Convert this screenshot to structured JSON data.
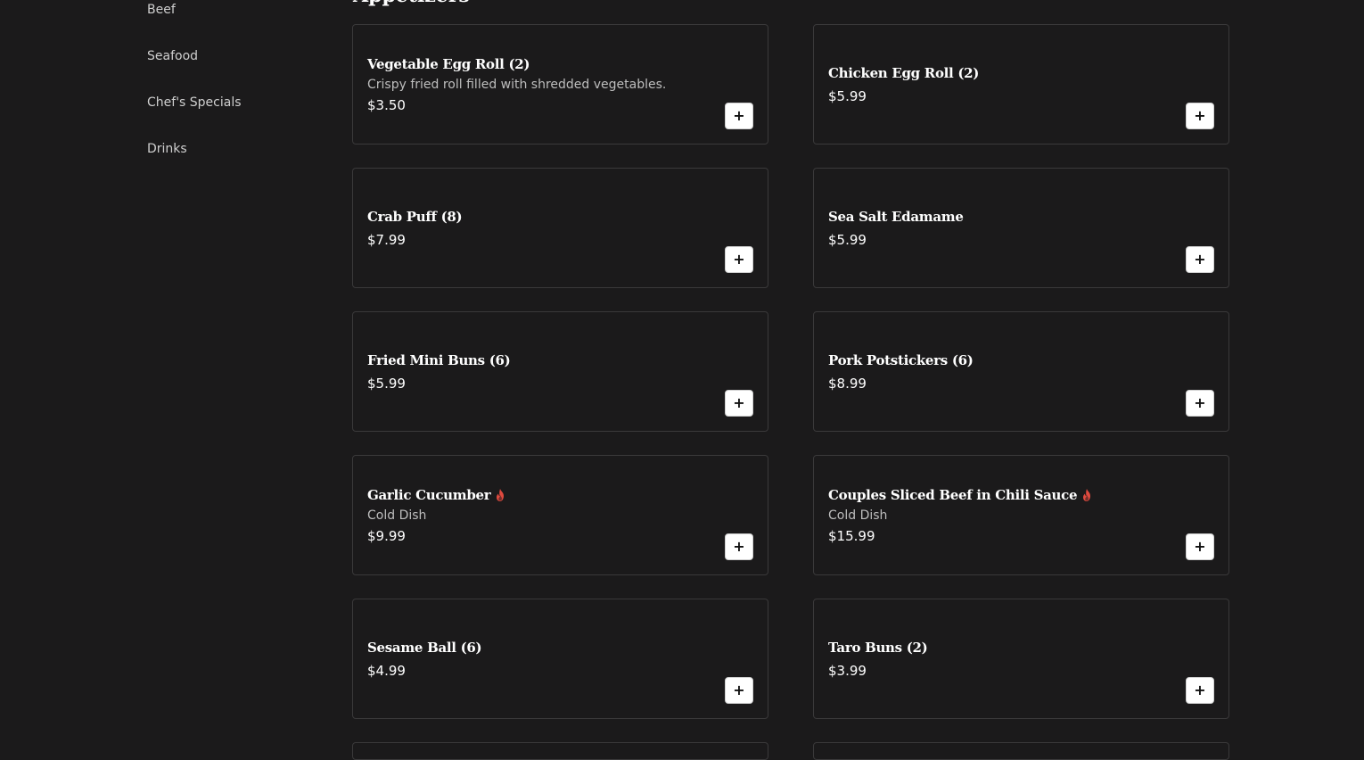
{
  "sidebar": {
    "items": [
      {
        "label": "Beef"
      },
      {
        "label": "Seafood"
      },
      {
        "label": "Chef's Specials"
      },
      {
        "label": "Drinks"
      }
    ]
  },
  "section": {
    "title": "Appetizers"
  },
  "colors": {
    "background": "#1b1a1b",
    "card_border": "#3a393a",
    "spicy": "#e04a3f",
    "add_button_bg": "#ffffff"
  },
  "items": [
    {
      "name": "Vegetable Egg Roll (2)",
      "description": "Crispy fried roll filled with shredded vegetables.",
      "price": "$3.50",
      "spicy": false
    },
    {
      "name": "Chicken Egg Roll (2)",
      "description": "",
      "price": "$5.99",
      "spicy": false
    },
    {
      "name": "Crab Puff (8)",
      "description": "",
      "price": "$7.99",
      "spicy": false
    },
    {
      "name": "Sea Salt Edamame",
      "description": "",
      "price": "$5.99",
      "spicy": false
    },
    {
      "name": "Fried Mini Buns (6)",
      "description": "",
      "price": "$5.99",
      "spicy": false
    },
    {
      "name": "Pork Potstickers (6)",
      "description": "",
      "price": "$8.99",
      "spicy": false
    },
    {
      "name": "Garlic Cucumber",
      "description": "Cold Dish",
      "price": "$9.99",
      "spicy": true
    },
    {
      "name": "Couples Sliced Beef in Chili Sauce",
      "description": "Cold Dish",
      "price": "$15.99",
      "spicy": true
    },
    {
      "name": "Sesame Ball (6)",
      "description": "",
      "price": "$4.99",
      "spicy": false
    },
    {
      "name": "Taro Buns (2)",
      "description": "",
      "price": "$3.99",
      "spicy": false
    }
  ],
  "add_button_icon": "plus-icon",
  "spicy_icon": "flame-icon"
}
